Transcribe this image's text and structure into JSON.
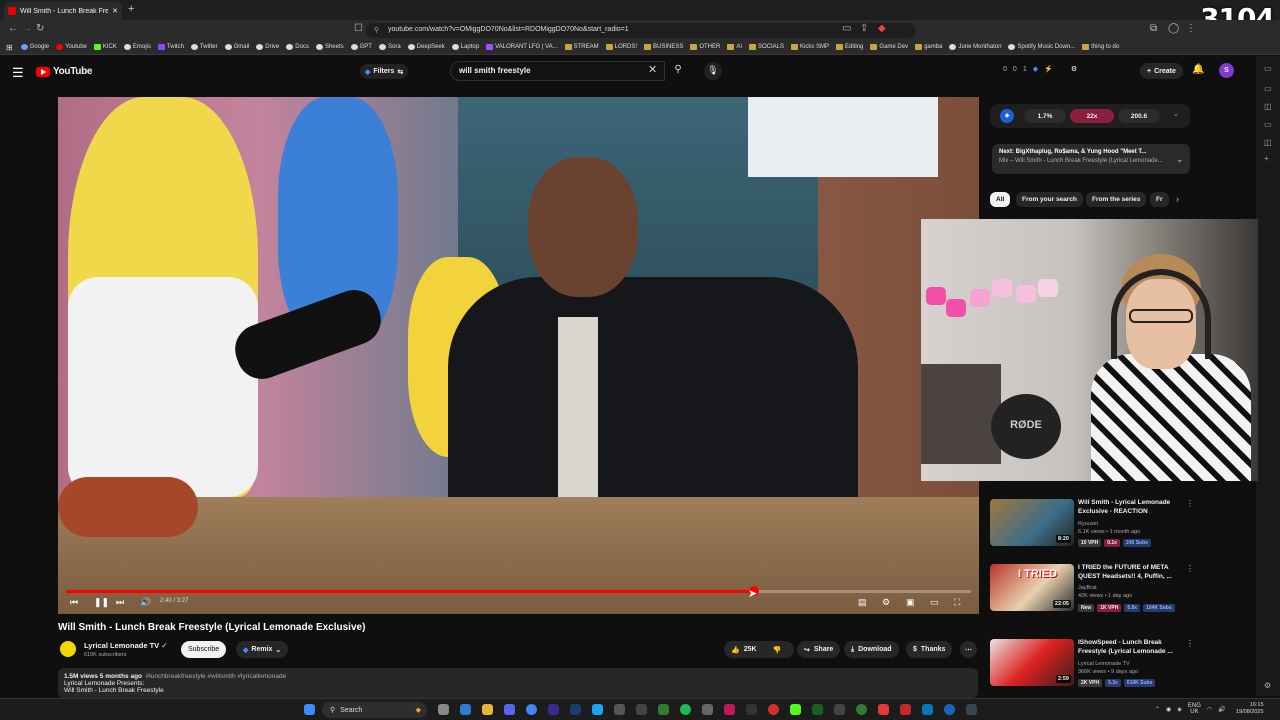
{
  "browser": {
    "tab_title": "Will Smith - Lunch Break Freest",
    "url": "youtube.com/watch?v=OMiggDO70No&list=RDOMiggDO70No&start_radio=1",
    "overlay_counter": "3104",
    "bookmarks": [
      "Google",
      "Youtube",
      "KICK",
      "Emojis",
      "Twitch",
      "Twitter",
      "Gmail",
      "Drive",
      "Docs",
      "Sheets",
      "GPT",
      "Sora",
      "DeepSeek",
      "Laptop",
      "VALORANT LFG | VA...",
      "STREAM",
      "LORDS!",
      "BUSINESS",
      "OTHER",
      "AI",
      "SOCIALS",
      "Kicks SMP",
      "Editing",
      "Game Dev",
      "gamba",
      "June Monthaton",
      "Spotify Music Down...",
      "thing to do"
    ]
  },
  "header": {
    "logo": "YouTube",
    "filters_label": "Filters",
    "search_value": "will smith freestyle",
    "create_label": "Create",
    "avatar_letter": "S",
    "stats": [
      "0",
      "0",
      "1"
    ]
  },
  "player": {
    "time": "2:40 / 3:27",
    "progress": 0.76
  },
  "video": {
    "title": "Will Smith - Lunch Break Freestyle (Lyrical Lemonade Exclusive)",
    "channel": "Lyrical Lemonade TV",
    "subscribers": "610K subscribers",
    "subscribe_label": "Subscribe",
    "remix_label": "Remix",
    "likes": "25K",
    "share_label": "Share",
    "download_label": "Download",
    "thanks_label": "Thanks",
    "views_meta": "1.5M views  5 months ago",
    "hashtags": "#lunchbreakfreestyle #willsmith #lyricallemonade",
    "desc_line1": "Lyrical Lemonade Presents:",
    "desc_line2": "Will Smith - Lunch Break Freestyle"
  },
  "extension": {
    "pill1": "1.7%",
    "pill2": "22x",
    "pill3": "200.6"
  },
  "up_next": {
    "title": "Next: BigXthaplug, Ro$ama, & Yung Hood \"Meet T...",
    "subtitle": "Mix – Will Smith - Lunch Break Freestyle (Lyrical Lemonade..."
  },
  "chips": [
    "All",
    "From your search",
    "From the series",
    "Fr"
  ],
  "recommendations": [
    {
      "title": "Will Smith - Lyrical Lemonade Exclusive - REACTION",
      "channel": "Ryuusei",
      "meta": "6.1K views • 1 month ago",
      "duration": "8:20",
      "badges": [
        "10 VPH",
        "0.1x",
        "245 Subs"
      ],
      "thumb_color": "#6e5a48"
    },
    {
      "title": "I TRIED the FUTURE of META QUEST Headsets!! 4, Puffin, ...",
      "channel": "JayBrat",
      "meta": "42K views • 1 day ago",
      "duration": "22:05",
      "badges": [
        "New",
        "1K VPH",
        "6.9x",
        "104K Subs"
      ],
      "thumb_color": "#8a2a22"
    },
    {
      "title": "IShowSpeed - Lunch Break Freestyle (Lyrical Lemonade ...",
      "channel": "Lyrical Lemonade TV",
      "meta": "366K views • 9 days ago",
      "duration": "2:59",
      "badges": [
        "2K VPH",
        "5.3x",
        "610K Subs"
      ],
      "thumb_color": "#5a2a24"
    }
  ],
  "taskbar": {
    "search_label": "Search",
    "lang": "ENG",
    "region": "UK",
    "time": "16:15",
    "date": "19/08/2025"
  }
}
